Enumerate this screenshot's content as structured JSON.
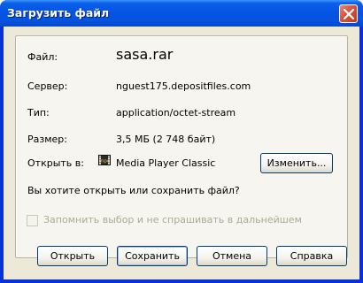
{
  "window": {
    "title": "Загрузить файл"
  },
  "fields": {
    "file_label": "Файл:",
    "file_value": "sasa.rar",
    "server_label": "Сервер:",
    "server_value": "nguest175.depositfiles.com",
    "type_label": "Тип:",
    "type_value": "application/octet-stream",
    "size_label": "Размер:",
    "size_value": "3,5 МБ (2 748 байт)",
    "open_in_label": "Открыть в:",
    "open_in_value": "Media Player Classic",
    "open_in_icon": "media-player-icon"
  },
  "change_button": "Изменить...",
  "question": "Вы хотите открыть или сохранить файл?",
  "remember": {
    "label": "Запомнить выбор и не спрашивать в дальнейшем",
    "checked": false,
    "enabled": false
  },
  "buttons": {
    "open": "Открыть",
    "save": "Сохранить",
    "cancel": "Отмена",
    "help": "Справка"
  },
  "colors": {
    "titlebar": "#0554e3",
    "dialog_bg": "#ece9d8",
    "close_button": "#d8533a"
  }
}
